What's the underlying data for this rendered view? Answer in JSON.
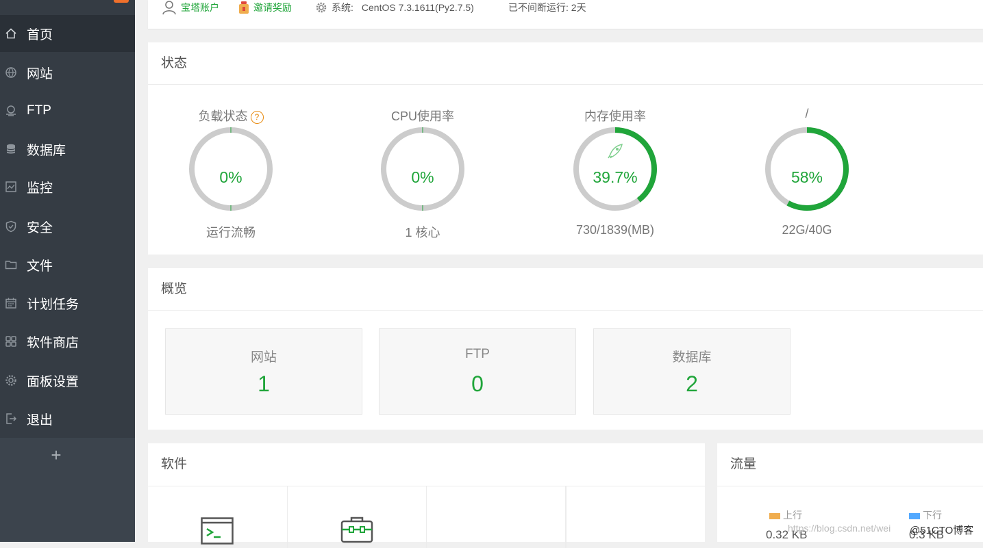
{
  "sidebar": {
    "items": [
      {
        "label": "首页",
        "icon": "home-icon"
      },
      {
        "label": "网站",
        "icon": "globe-icon"
      },
      {
        "label": "FTP",
        "icon": "ftp-icon"
      },
      {
        "label": "数据库",
        "icon": "database-icon"
      },
      {
        "label": "监控",
        "icon": "monitor-icon"
      },
      {
        "label": "安全",
        "icon": "shield-icon"
      },
      {
        "label": "文件",
        "icon": "folder-icon"
      },
      {
        "label": "计划任务",
        "icon": "calendar-icon"
      },
      {
        "label": "软件商店",
        "icon": "grid-icon"
      },
      {
        "label": "面板设置",
        "icon": "gear-icon"
      },
      {
        "label": "退出",
        "icon": "logout-icon"
      }
    ],
    "add_symbol": "+"
  },
  "header": {
    "account_label": "宝塔账户",
    "invite_label": "邀请奖励",
    "system_prefix": "系统:",
    "system_value": "CentOS 7.3.1611(Py2.7.5)",
    "uptime": "已不间断运行: 2天"
  },
  "status": {
    "title": "状态",
    "help_symbol": "?",
    "gauges": [
      {
        "label": "负载状态",
        "value": "0%",
        "percent": 0,
        "sub": "运行流畅",
        "has_help": true
      },
      {
        "label": "CPU使用率",
        "value": "0%",
        "percent": 0,
        "sub": "1 核心"
      },
      {
        "label": "内存使用率",
        "value": "39.7%",
        "percent": 39.7,
        "sub": "730/1839(MB)",
        "icon": "rocket-icon"
      },
      {
        "label": "/",
        "value": "58%",
        "percent": 58,
        "sub": "22G/40G"
      }
    ]
  },
  "overview": {
    "title": "概览",
    "cards": [
      {
        "label": "网站",
        "value": "1"
      },
      {
        "label": "FTP",
        "value": "0"
      },
      {
        "label": "数据库",
        "value": "2"
      }
    ]
  },
  "software": {
    "title": "软件",
    "icons": [
      "terminal-icon",
      "toolbox-icon"
    ]
  },
  "traffic": {
    "title": "流量",
    "up_label": "上行",
    "down_label": "下行",
    "up_value": "0.32 KB",
    "down_value": "0.3 KB"
  },
  "watermark": {
    "url": "https://blog.csdn.net/wei",
    "brand": "@51CTO博客"
  },
  "colors": {
    "accent": "#20a53a",
    "sidebar": "#353c44",
    "up": "#f0ad4e",
    "down": "#52a9ff"
  }
}
